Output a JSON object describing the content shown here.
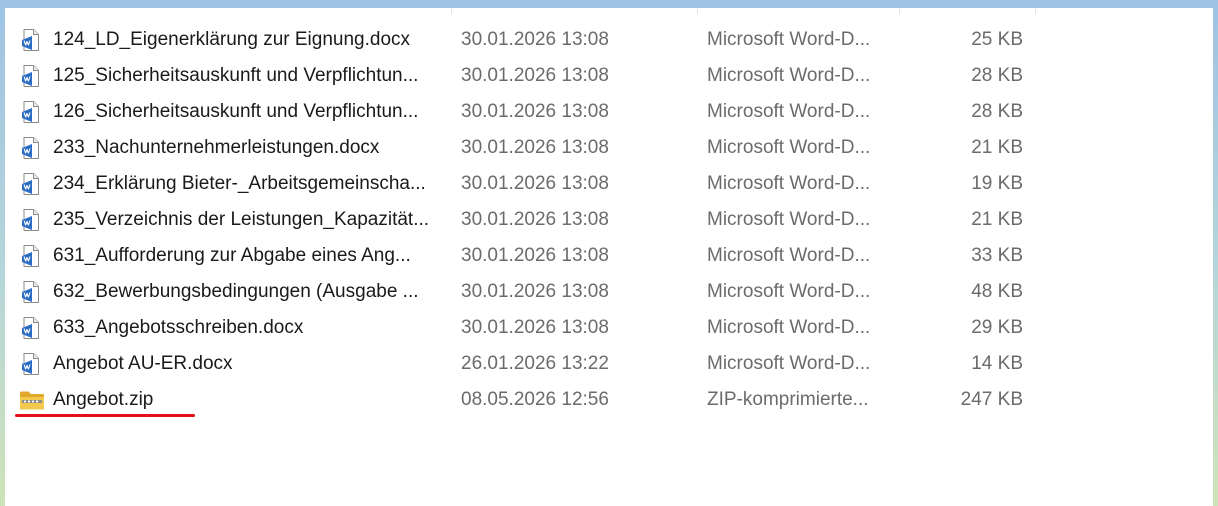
{
  "files": [
    {
      "name": "124_LD_Eigenerklärung zur Eignung.docx",
      "date": "30.01.2026 13:08",
      "type": "Microsoft Word-D...",
      "size": "25 KB",
      "icon": "word-document-icon"
    },
    {
      "name": "125_Sicherheitsauskunft und Verpflichtun...",
      "date": "30.01.2026 13:08",
      "type": "Microsoft Word-D...",
      "size": "28 KB",
      "icon": "word-document-icon"
    },
    {
      "name": "126_Sicherheitsauskunft und Verpflichtun...",
      "date": "30.01.2026 13:08",
      "type": "Microsoft Word-D...",
      "size": "28 KB",
      "icon": "word-document-icon"
    },
    {
      "name": "233_Nachunternehmerleistungen.docx",
      "date": "30.01.2026 13:08",
      "type": "Microsoft Word-D...",
      "size": "21 KB",
      "icon": "word-document-icon"
    },
    {
      "name": "234_Erklärung Bieter-_Arbeitsgemeinscha...",
      "date": "30.01.2026 13:08",
      "type": "Microsoft Word-D...",
      "size": "19 KB",
      "icon": "word-document-icon"
    },
    {
      "name": "235_Verzeichnis der Leistungen_Kapazität...",
      "date": "30.01.2026 13:08",
      "type": "Microsoft Word-D...",
      "size": "21 KB",
      "icon": "word-document-icon"
    },
    {
      "name": "631_Aufforderung zur Abgabe eines Ang...",
      "date": "30.01.2026 13:08",
      "type": "Microsoft Word-D...",
      "size": "33 KB",
      "icon": "word-document-icon"
    },
    {
      "name": "632_Bewerbungsbedingungen (Ausgabe ...",
      "date": "30.01.2026 13:08",
      "type": "Microsoft Word-D...",
      "size": "48 KB",
      "icon": "word-document-icon"
    },
    {
      "name": "633_Angebotsschreiben.docx",
      "date": "30.01.2026 13:08",
      "type": "Microsoft Word-D...",
      "size": "29 KB",
      "icon": "word-document-icon"
    },
    {
      "name": "Angebot AU-ER.docx",
      "date": "26.01.2026 13:22",
      "type": "Microsoft Word-D...",
      "size": "14 KB",
      "icon": "word-document-icon"
    },
    {
      "name": "Angebot.zip",
      "date": "08.05.2026 12:56",
      "type": "ZIP-komprimierte...",
      "size": "247 KB",
      "icon": "zip-folder-icon",
      "highlighted": true
    }
  ],
  "colors": {
    "highlight_underline": "#e3101b",
    "text_primary": "#1a1a1a",
    "text_secondary": "#6b6b6b",
    "word_icon_blue": "#2b6cc4",
    "zip_folder_yellow": "#f2c94c"
  }
}
